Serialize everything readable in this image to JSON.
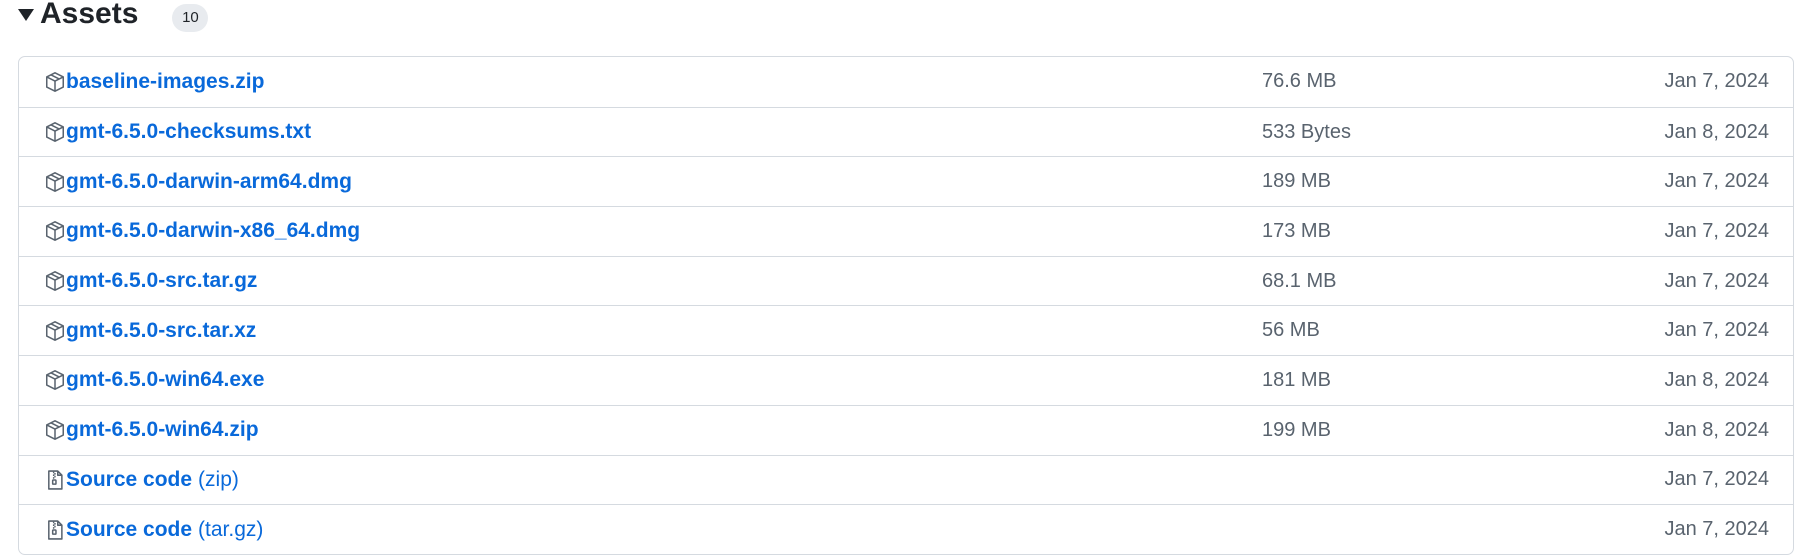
{
  "assets": {
    "title": "Assets",
    "count": "10",
    "rows": [
      {
        "name": "baseline-images.zip",
        "suffix": "",
        "size": "76.6 MB",
        "date": "Jan 7, 2024",
        "icon": "package-icon"
      },
      {
        "name": "gmt-6.5.0-checksums.txt",
        "suffix": "",
        "size": "533 Bytes",
        "date": "Jan 8, 2024",
        "icon": "package-icon"
      },
      {
        "name": "gmt-6.5.0-darwin-arm64.dmg",
        "suffix": "",
        "size": "189 MB",
        "date": "Jan 7, 2024",
        "icon": "package-icon"
      },
      {
        "name": "gmt-6.5.0-darwin-x86_64.dmg",
        "suffix": "",
        "size": "173 MB",
        "date": "Jan 7, 2024",
        "icon": "package-icon"
      },
      {
        "name": "gmt-6.5.0-src.tar.gz",
        "suffix": "",
        "size": "68.1 MB",
        "date": "Jan 7, 2024",
        "icon": "package-icon"
      },
      {
        "name": "gmt-6.5.0-src.tar.xz",
        "suffix": "",
        "size": "56 MB",
        "date": "Jan 7, 2024",
        "icon": "package-icon"
      },
      {
        "name": "gmt-6.5.0-win64.exe",
        "suffix": "",
        "size": "181 MB",
        "date": "Jan 8, 2024",
        "icon": "package-icon"
      },
      {
        "name": "gmt-6.5.0-win64.zip",
        "suffix": "",
        "size": "199 MB",
        "date": "Jan 8, 2024",
        "icon": "package-icon"
      },
      {
        "name": "Source code",
        "suffix": "(zip)",
        "size": "",
        "date": "Jan 7, 2024",
        "icon": "file-zip-icon"
      },
      {
        "name": "Source code",
        "suffix": "(tar.gz)",
        "size": "",
        "date": "Jan 7, 2024",
        "icon": "file-zip-icon"
      }
    ]
  },
  "colors": {
    "link": "#0969da",
    "muted": "#59636e",
    "border": "#d5dae0",
    "counter_bg": "#e8ebef"
  }
}
